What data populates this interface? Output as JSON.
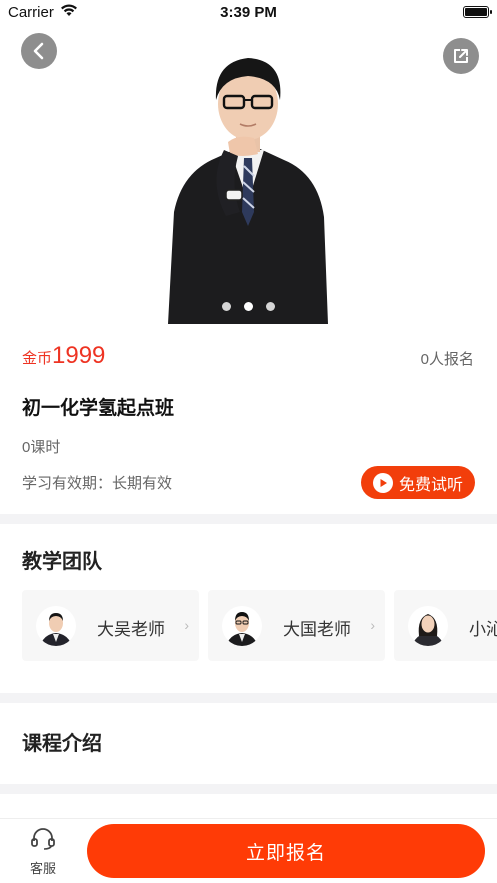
{
  "status_bar": {
    "carrier": "Carrier",
    "time": "3:39 PM"
  },
  "hero": {
    "carousel_total": 3,
    "carousel_active_index": 1
  },
  "course": {
    "price_unit": "金币",
    "price": "1999",
    "enrolled": "0人报名",
    "title": "初一化学氢起点班",
    "lessons": "0课时",
    "validity": "学习有效期：长期有效",
    "trial_label": "免费试听"
  },
  "team": {
    "title": "教学团队",
    "teachers": [
      {
        "name": "大吴老师"
      },
      {
        "name": "大国老师"
      },
      {
        "name": "小沁"
      }
    ]
  },
  "intro": {
    "title": "课程介绍"
  },
  "bottom_bar": {
    "service_label": "客服",
    "enroll_label": "立即报名"
  },
  "colors": {
    "accent": "#ff3b06",
    "price": "#ee3322"
  }
}
